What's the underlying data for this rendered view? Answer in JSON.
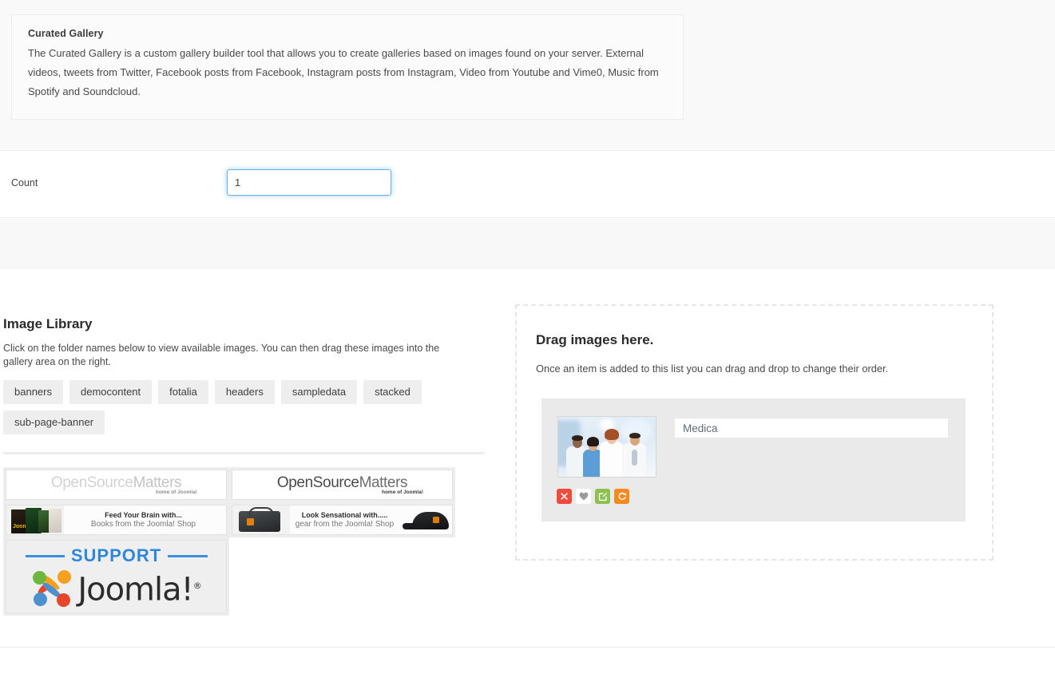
{
  "description_panel": {
    "title": "Curated Gallery",
    "body": "The Curated Gallery is a custom gallery builder tool that allows you to create galleries based on images found on your server. External videos, tweets from Twitter, Facebook posts from Facebook, Instagram posts from Instagram, Video from Youtube and Vime0, Music from Spotify and Soundcloud."
  },
  "count_field": {
    "label": "Count",
    "value": "1",
    "placeholder": ""
  },
  "image_library": {
    "title": "Image Library",
    "help": "Click on the folder names below to view available images. You can then drag these images into the gallery area on the right.",
    "folders": [
      {
        "label": "banners"
      },
      {
        "label": "democontent"
      },
      {
        "label": "fotalia"
      },
      {
        "label": "headers"
      },
      {
        "label": "sampledata"
      },
      {
        "label": "stacked"
      },
      {
        "label": "sub-page-banner"
      }
    ],
    "thumbnails": [
      {
        "name": "osm-banner-light",
        "line1": "OpenSource",
        "line2": "Matters",
        "sub": "home of Joomla!"
      },
      {
        "name": "osm-banner-dark",
        "line1": "OpenSource",
        "line2": "Matters",
        "sub": "home of Joomla!"
      },
      {
        "name": "joomla-books-banner",
        "line1": "Feed Your Brain with...",
        "line2": "Books from the Joomla! Shop"
      },
      {
        "name": "joomla-gear-banner",
        "line1": "Look Sensational with.....",
        "line2": "gear from the Joomla! Shop"
      },
      {
        "name": "support-joomla-banner",
        "line1": "SUPPORT",
        "line2": "Joomla!",
        "registered": "®"
      }
    ]
  },
  "drop_zone": {
    "title": "Drag images here.",
    "subtitle": "Once an item is added to this list you can drag and drop to change their order.",
    "items": [
      {
        "title_value": "Medica",
        "thumb_alt": "medical-team-photo",
        "actions": [
          {
            "name": "delete-button",
            "icon": "close-icon",
            "color": "#ef4b3c"
          },
          {
            "name": "favorite-button",
            "icon": "heart-icon",
            "color": "#ffffff"
          },
          {
            "name": "edit-button",
            "icon": "pencil-square-icon",
            "color": "#8cc152"
          },
          {
            "name": "reload-button",
            "icon": "redo-icon",
            "color": "#f78a1e"
          }
        ]
      }
    ]
  },
  "colors": {
    "focus_border": "#66afe9",
    "panel_bg": "#f9f9f9",
    "tag_bg": "#eeeeee",
    "card_bg": "#eaeaea",
    "dashed_border": "#e6e6e6"
  }
}
